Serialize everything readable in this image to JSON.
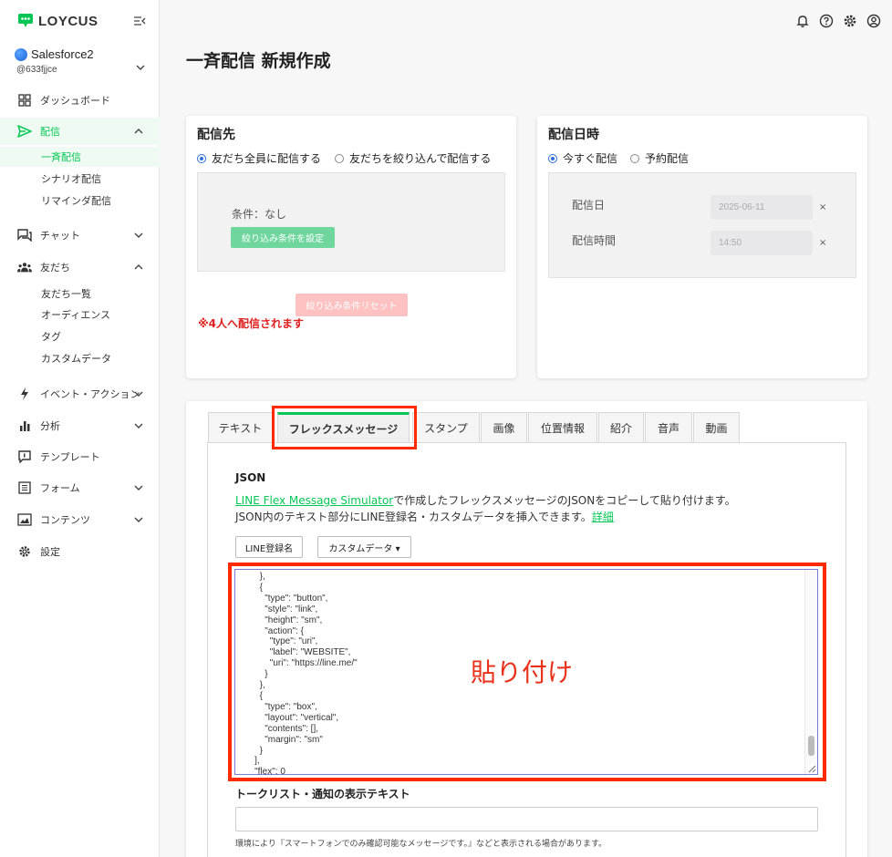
{
  "brand": {
    "name": "LOYCUS"
  },
  "account": {
    "name": "Salesforce2",
    "id": "@633fjjce"
  },
  "sidebar": {
    "items": [
      {
        "label": "ダッシュボード"
      },
      {
        "label": "配信"
      },
      {
        "label": "チャット"
      },
      {
        "label": "友だち"
      },
      {
        "label": "イベント・アクション"
      },
      {
        "label": "分析"
      },
      {
        "label": "テンプレート"
      },
      {
        "label": "フォーム"
      },
      {
        "label": "コンテンツ"
      },
      {
        "label": "設定"
      }
    ],
    "delivery_sub": [
      {
        "label": "一斉配信"
      },
      {
        "label": "シナリオ配信"
      },
      {
        "label": "リマインダ配信"
      }
    ],
    "friends_sub": [
      {
        "label": "友だち一覧"
      },
      {
        "label": "オーディエンス"
      },
      {
        "label": "タグ"
      },
      {
        "label": "カスタムデータ"
      }
    ]
  },
  "page": {
    "title": "一斉配信 新規作成"
  },
  "destination": {
    "title": "配信先",
    "radio_all": "友だち全員に配信する",
    "radio_filter": "友だちを絞り込んで配信する",
    "condition": "条件：なし",
    "set_filter_button": "絞り込み条件を設定",
    "reset_filter_button": "絞り込み条件リセット",
    "recipients_note": "※4人へ配信されます"
  },
  "schedule": {
    "title": "配信日時",
    "radio_now": "今すぐ配信",
    "radio_reserve": "予約配信",
    "date_label": "配信日",
    "date_value": "2025-06-11",
    "time_label": "配信時間",
    "time_value": "14:50",
    "clear": "×"
  },
  "tabs": [
    {
      "label": "テキスト"
    },
    {
      "label": "フレックスメッセージ"
    },
    {
      "label": "スタンプ"
    },
    {
      "label": "画像"
    },
    {
      "label": "位置情報"
    },
    {
      "label": "紹介"
    },
    {
      "label": "音声"
    },
    {
      "label": "動画"
    }
  ],
  "flex": {
    "json_title": "JSON",
    "simulator_link": "LINE Flex Message Simulator",
    "desc_line1_rest": "で作成したフレックスメッセージのJSONをコピーして貼り付けます。",
    "desc_line2": "JSON内のテキスト部分にLINE登録名・カスタムデータを挿入できます。",
    "detail_link": "詳細",
    "line_name_button": "LINE登録名",
    "custom_data_button": "カスタムデータ ▾",
    "json_content": "      },\n      {\n        \"type\": \"button\",\n        \"style\": \"link\",\n        \"height\": \"sm\",\n        \"action\": {\n          \"type\": \"uri\",\n          \"label\": \"WEBSITE\",\n          \"uri\": \"https://line.me/\"\n        }\n      },\n      {\n        \"type\": \"box\",\n        \"layout\": \"vertical\",\n        \"contents\": [],\n        \"margin\": \"sm\"\n      }\n    ],\n    \"flex\": 0\n  }\n}",
    "paste_note": "貼り付け",
    "talk_label": "トークリスト・通知の表示テキスト",
    "talk_note": "環境により『スマートフォンでのみ確認可能なメッセージです。』などと表示される場合があります。"
  },
  "colors": {
    "accent": "#06c755",
    "warning": "#e02020",
    "highlight": "#ff2a00"
  }
}
